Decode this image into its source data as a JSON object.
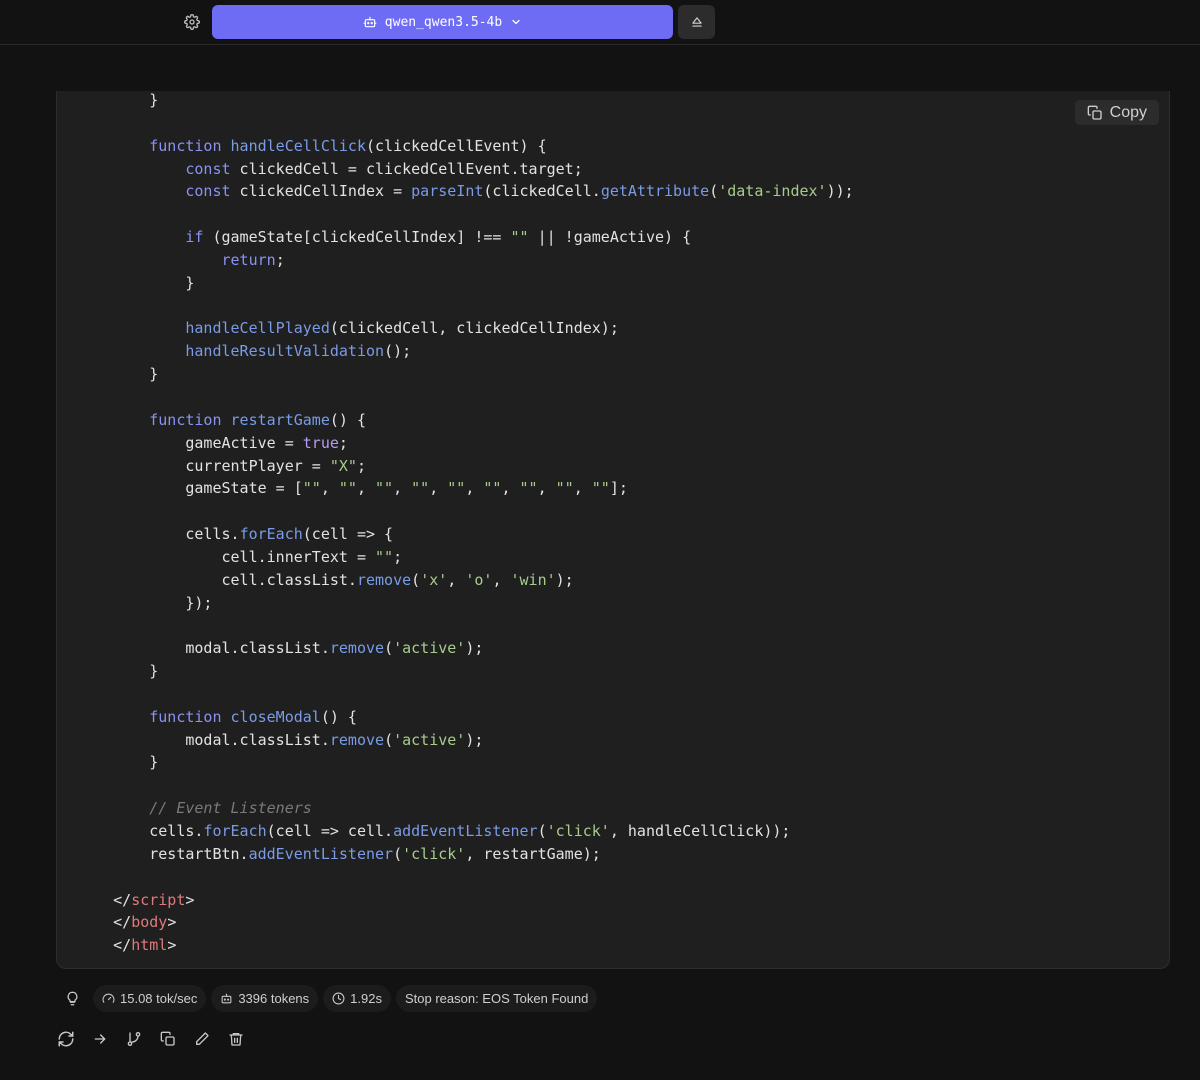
{
  "header": {
    "model_label": "qwen_qwen3.5-4b",
    "settings_icon": "gear-icon",
    "model_icon": "robot-icon",
    "dropdown_icon": "chevron-down-icon",
    "eject_icon": "eject-icon",
    "accent_color": "#6e6cf5"
  },
  "code_block": {
    "copy_label": "Copy",
    "copy_icon": "copy-icon"
  },
  "stats": {
    "speed": "15.08 tok/sec",
    "tokens": "3396 tokens",
    "time": "1.92s",
    "stop_reason": "Stop reason: EOS Token Found"
  },
  "actions": [
    "regenerate",
    "continue",
    "branch",
    "copy",
    "edit",
    "delete"
  ]
}
